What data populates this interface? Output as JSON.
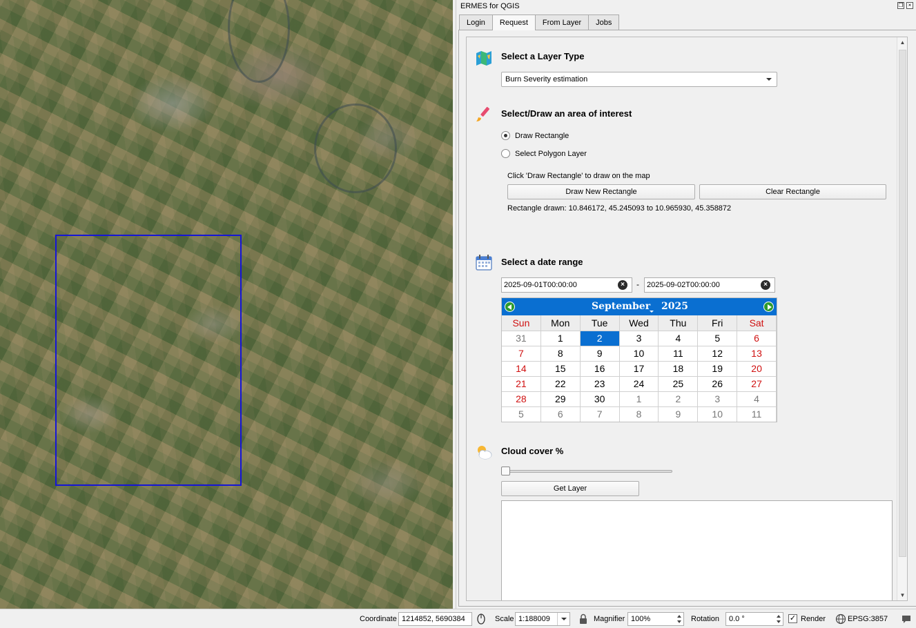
{
  "dock": {
    "title": "ERMES for QGIS",
    "tabs": [
      "Login",
      "Request",
      "From Layer",
      "Jobs"
    ]
  },
  "layer_type": {
    "title": "Select a Layer Type",
    "selected": "Burn Severity estimation"
  },
  "aoi": {
    "title": "Select/Draw an area of interest",
    "option_rectangle": "Draw Rectangle",
    "option_polygon": "Select Polygon Layer",
    "hint": "Click 'Draw Rectangle' to draw on the map",
    "draw_button": "Draw New Rectangle",
    "clear_button": "Clear Rectangle",
    "status": "Rectangle drawn: 10.846172, 45.245093 to 10.965930, 45.358872"
  },
  "date_range": {
    "title": "Select a date range",
    "start": "2025-09-01T00:00:00",
    "separator": "-",
    "end": "2025-09-02T00:00:00"
  },
  "calendar": {
    "month": "September",
    "year": "2025",
    "weekdays": [
      "Sun",
      "Mon",
      "Tue",
      "Wed",
      "Thu",
      "Fri",
      "Sat"
    ],
    "weeks": [
      [
        "31",
        "1",
        "2",
        "3",
        "4",
        "5",
        "6"
      ],
      [
        "7",
        "8",
        "9",
        "10",
        "11",
        "12",
        "13"
      ],
      [
        "14",
        "15",
        "16",
        "17",
        "18",
        "19",
        "20"
      ],
      [
        "21",
        "22",
        "23",
        "24",
        "25",
        "26",
        "27"
      ],
      [
        "28",
        "29",
        "30",
        "1",
        "2",
        "3",
        "4"
      ],
      [
        "5",
        "6",
        "7",
        "8",
        "9",
        "10",
        "11"
      ]
    ],
    "selected_day": "2"
  },
  "cloud": {
    "title": "Cloud cover %",
    "value_fraction": 0.0,
    "get_layer_button": "Get Layer"
  },
  "statusbar": {
    "coordinate_label": "Coordinate",
    "coordinate_value": "1214852, 5690384",
    "scale_label": "Scale",
    "scale_value": "1:188009",
    "magnifier_label": "Magnifier",
    "magnifier_value": "100%",
    "rotation_label": "Rotation",
    "rotation_value": "0.0 °",
    "render_label": "Render",
    "crs": "EPSG:3857"
  },
  "colors": {
    "calendar_header": "#0a6fd1",
    "weekend": "#d01010",
    "aoi_rectangle": "#1515d8"
  }
}
